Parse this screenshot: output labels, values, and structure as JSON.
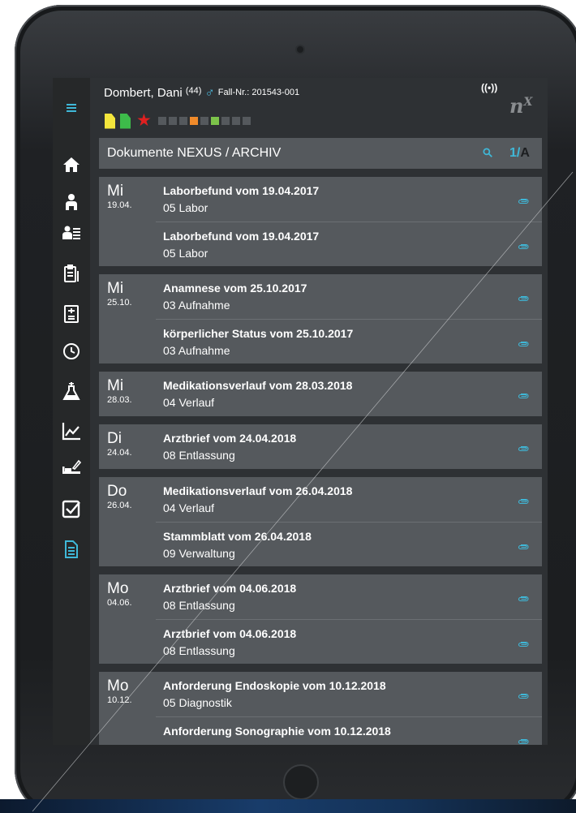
{
  "patient": {
    "name": "Dombert, Dani",
    "age": "(44)",
    "gender_symbol": "♂",
    "case_label": "Fall-Nr.: 201543-001"
  },
  "header": {
    "signal": "((•))",
    "logo": "n",
    "logo_sup": "X"
  },
  "flags": {
    "doc_colors": [
      "#f4e63c",
      "#3dbb4a"
    ],
    "star_color": "#e02020",
    "status_squares": [
      "#55595d",
      "#55595d",
      "#55595d",
      "#f08a2a",
      "#55595d",
      "#7cc34a",
      "#55595d",
      "#55595d",
      "#55595d"
    ]
  },
  "title_bar": {
    "title": "Dokumente NEXUS / ARCHIV",
    "search_icon": "search-icon",
    "page": "1/",
    "page_suffix": "A"
  },
  "sidebar": {
    "items": [
      {
        "icon": "menu-icon"
      },
      {
        "icon": "home-icon"
      },
      {
        "icon": "person-icon"
      },
      {
        "icon": "person-list-icon"
      },
      {
        "icon": "clipboard-icon"
      },
      {
        "icon": "form-icon"
      },
      {
        "icon": "clock-icon"
      },
      {
        "icon": "lab-flask-icon"
      },
      {
        "icon": "chart-icon"
      },
      {
        "icon": "bed-icon"
      },
      {
        "icon": "checkbox-icon"
      },
      {
        "icon": "document-icon",
        "active": true
      }
    ]
  },
  "accent_color": "#3fb8d8",
  "groups": [
    {
      "dow": "Mi",
      "date": "19.04.",
      "docs": [
        {
          "title": "Laborbefund vom 19.04.2017",
          "category": "05 Labor"
        },
        {
          "title": "Laborbefund vom 19.04.2017",
          "category": "05 Labor"
        }
      ]
    },
    {
      "dow": "Mi",
      "date": "25.10.",
      "docs": [
        {
          "title": "Anamnese vom 25.10.2017",
          "category": "03 Aufnahme"
        },
        {
          "title": "körperlicher Status vom 25.10.2017",
          "category": "03 Aufnahme"
        }
      ]
    },
    {
      "dow": "Mi",
      "date": "28.03.",
      "docs": [
        {
          "title": "Medikationsverlauf vom 28.03.2018",
          "category": "04 Verlauf"
        }
      ]
    },
    {
      "dow": "Di",
      "date": "24.04.",
      "docs": [
        {
          "title": "Arztbrief vom 24.04.2018",
          "category": "08 Entlassung"
        }
      ]
    },
    {
      "dow": "Do",
      "date": "26.04.",
      "docs": [
        {
          "title": "Medikationsverlauf vom 26.04.2018",
          "category": "04 Verlauf"
        },
        {
          "title": "Stammblatt vom 26.04.2018",
          "category": "09 Verwaltung"
        }
      ]
    },
    {
      "dow": "Mo",
      "date": "04.06.",
      "docs": [
        {
          "title": "Arztbrief vom 04.06.2018",
          "category": "08 Entlassung"
        },
        {
          "title": "Arztbrief vom 04.06.2018",
          "category": "08 Entlassung"
        }
      ]
    },
    {
      "dow": "Mo",
      "date": "10.12.",
      "docs": [
        {
          "title": "Anforderung Endoskopie vom 10.12.2018",
          "category": "05 Diagnostik"
        },
        {
          "title": "Anforderung Sonographie vom 10.12.2018",
          "category": ""
        }
      ]
    }
  ]
}
